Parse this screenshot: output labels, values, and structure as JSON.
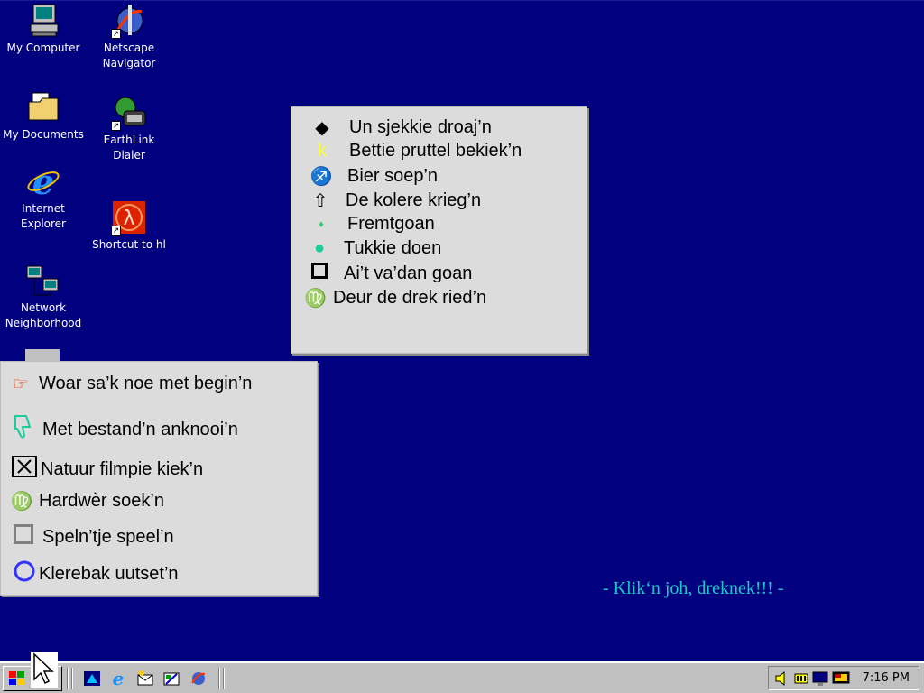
{
  "desktop_icons": [
    {
      "label": "My Computer",
      "icon": "my-computer-icon"
    },
    {
      "label": "Netscape\nNavigator",
      "icon": "netscape-icon"
    },
    {
      "label": "My Documents",
      "icon": "my-documents-icon"
    },
    {
      "label": "EarthLink\nDialer",
      "icon": "earthlink-icon"
    },
    {
      "label": "Internet\nExplorer",
      "icon": "ie-icon"
    },
    {
      "label": "Shortcut to hl",
      "icon": "hl-icon"
    },
    {
      "label": "Network\nNeighborhood",
      "icon": "network-icon"
    }
  ],
  "top_menu": {
    "items": [
      {
        "bullet": "◆",
        "label": "Un sjekkie droaj’n",
        "color": "#000000"
      },
      {
        "bullet": "k",
        "label": "Bettie pruttel bekiek’n",
        "color": "#FFFF33"
      },
      {
        "bullet": "♐",
        "label": "Bier soep’n",
        "color": "#3333FF"
      },
      {
        "bullet": "⇧",
        "label": "De kolere krieg’n",
        "color": "#000000"
      },
      {
        "bullet": "♦",
        "label": "Fremtgoan",
        "color": "#33CC66"
      },
      {
        "bullet": "●",
        "label": "Tukkie doen",
        "color": "#1ACC99"
      },
      {
        "bullet": "◻",
        "label": "Ai’t va’dan goan",
        "color": "#000000"
      },
      {
        "bullet": "♍",
        "label": "Deur de drek ried’n",
        "color": "#FF3300"
      }
    ]
  },
  "bottom_menu": {
    "items": [
      {
        "bullet": "☞",
        "label": "Woar sa’k noe met begin’n",
        "color": "#FF3300"
      },
      {
        "bullet": "👎",
        "label": "Met bestand’n anknooi’n",
        "color": "#1ACC99"
      },
      {
        "bullet": "☒",
        "label": "Natuur filmpie kiek’n",
        "color": "#000000"
      },
      {
        "bullet": "♍",
        "label": "Hardwèr soek’n",
        "color": "#FFFF33"
      },
      {
        "bullet": "◻",
        "label": "Speln’tje speel’n",
        "color": "#808080"
      },
      {
        "bullet": "❍",
        "label": "Klerebak uutset’n",
        "color": "#3333FF"
      }
    ]
  },
  "tagline": "- Klik‘n joh, dreknek!!! -",
  "taskbar": {
    "start_icon": "windows-logo-icon",
    "quick_launch": [
      "desktop-icon",
      "ie-icon",
      "outlook-icon",
      "channels-icon",
      "netscape-icon"
    ],
    "tray_icons": [
      "volume-icon",
      "power-icon",
      "network-icon",
      "display-icon"
    ],
    "clock": "7:16 PM"
  }
}
